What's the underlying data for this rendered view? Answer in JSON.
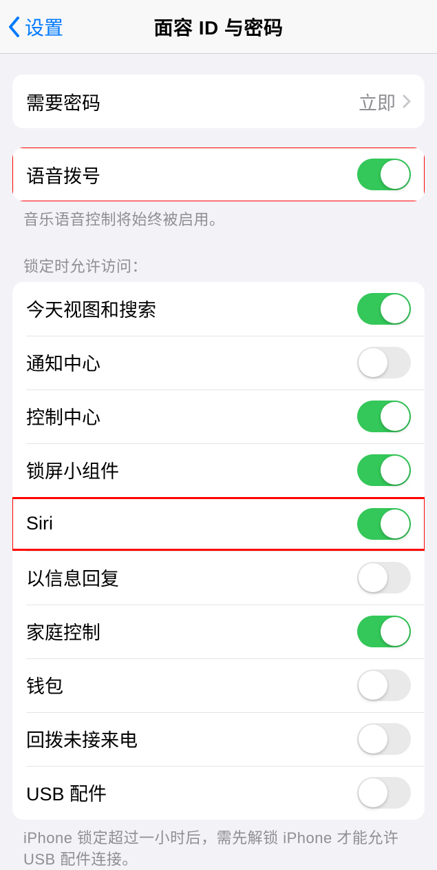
{
  "nav": {
    "back_label": "设置",
    "title": "面容 ID 与密码"
  },
  "passcode_group": {
    "require_passcode": {
      "label": "需要密码",
      "value": "立即"
    }
  },
  "voice_dial": {
    "label": "语音拨号",
    "on": true,
    "footer": "音乐语音控制将始终被启用。"
  },
  "lock_access": {
    "header": "锁定时允许访问：",
    "items": [
      {
        "label": "今天视图和搜索",
        "on": true
      },
      {
        "label": "通知中心",
        "on": false
      },
      {
        "label": "控制中心",
        "on": true
      },
      {
        "label": "锁屏小组件",
        "on": true
      },
      {
        "label": "Siri",
        "on": true
      },
      {
        "label": "以信息回复",
        "on": false
      },
      {
        "label": "家庭控制",
        "on": true
      },
      {
        "label": "钱包",
        "on": false
      },
      {
        "label": "回拨未接来电",
        "on": false
      },
      {
        "label": "USB 配件",
        "on": false
      }
    ],
    "footer": "iPhone 锁定超过一小时后，需先解锁 iPhone 才能允许 USB 配件连接。"
  }
}
